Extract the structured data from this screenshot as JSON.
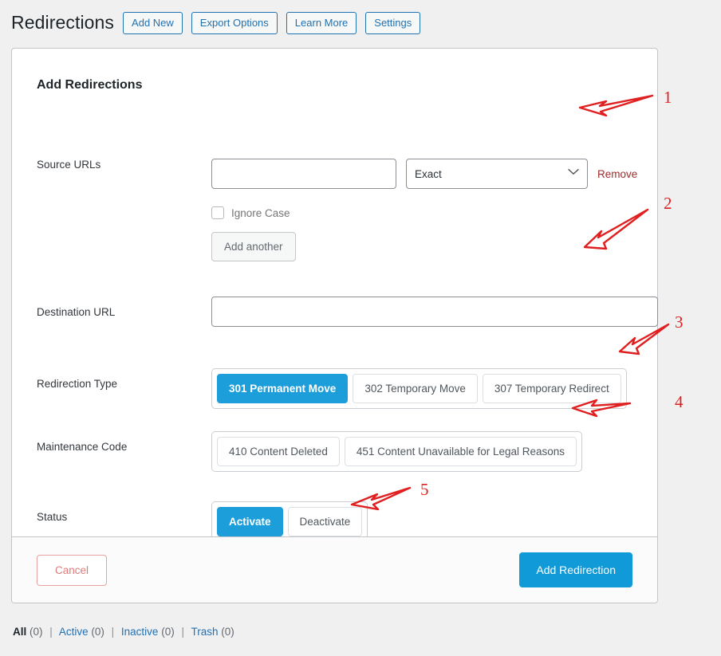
{
  "header": {
    "title": "Redirections",
    "buttons": [
      {
        "label": "Add New",
        "name": "add-new-button"
      },
      {
        "label": "Export Options",
        "name": "export-options-button"
      },
      {
        "label": "Learn More",
        "name": "learn-more-button"
      },
      {
        "label": "Settings",
        "name": "settings-button"
      }
    ]
  },
  "form": {
    "title": "Add Redirections",
    "source": {
      "label": "Source URLs",
      "input_value": "",
      "input_placeholder": "",
      "match_type_selected": "Exact",
      "match_type_caret_icon": "chevron-down-icon",
      "remove_label": "Remove",
      "ignore_case_label": "Ignore Case",
      "ignore_case_checked": false,
      "add_another_label": "Add another"
    },
    "destination": {
      "label": "Destination URL",
      "input_value": "",
      "input_placeholder": ""
    },
    "redirection_type": {
      "label": "Redirection Type",
      "options": [
        {
          "label": "301 Permanent Move",
          "selected": true
        },
        {
          "label": "302 Temporary Move",
          "selected": false
        },
        {
          "label": "307 Temporary Redirect",
          "selected": false
        }
      ]
    },
    "maintenance_code": {
      "label": "Maintenance Code",
      "options": [
        {
          "label": "410 Content Deleted",
          "selected": false
        },
        {
          "label": "451 Content Unavailable for Legal Reasons",
          "selected": false
        }
      ]
    },
    "status": {
      "label": "Status",
      "options": [
        {
          "label": "Activate",
          "selected": true
        },
        {
          "label": "Deactivate",
          "selected": false
        }
      ]
    },
    "footer": {
      "cancel_label": "Cancel",
      "submit_label": "Add Redirection"
    }
  },
  "filters": [
    {
      "label": "All",
      "count": "(0)",
      "current": true
    },
    {
      "label": "Active",
      "count": "(0)",
      "current": false
    },
    {
      "label": "Inactive",
      "count": "(0)",
      "current": false
    },
    {
      "label": "Trash",
      "count": "(0)",
      "current": false
    }
  ],
  "annotations": {
    "color": "#e02020",
    "markers": [
      {
        "number": "1"
      },
      {
        "number": "2"
      },
      {
        "number": "3"
      },
      {
        "number": "4"
      },
      {
        "number": "5"
      }
    ]
  },
  "colors": {
    "accent_blue": "#119ad8",
    "link_blue": "#2271b1",
    "page_background": "#f0f0f1",
    "annotation_red": "#e02020"
  }
}
